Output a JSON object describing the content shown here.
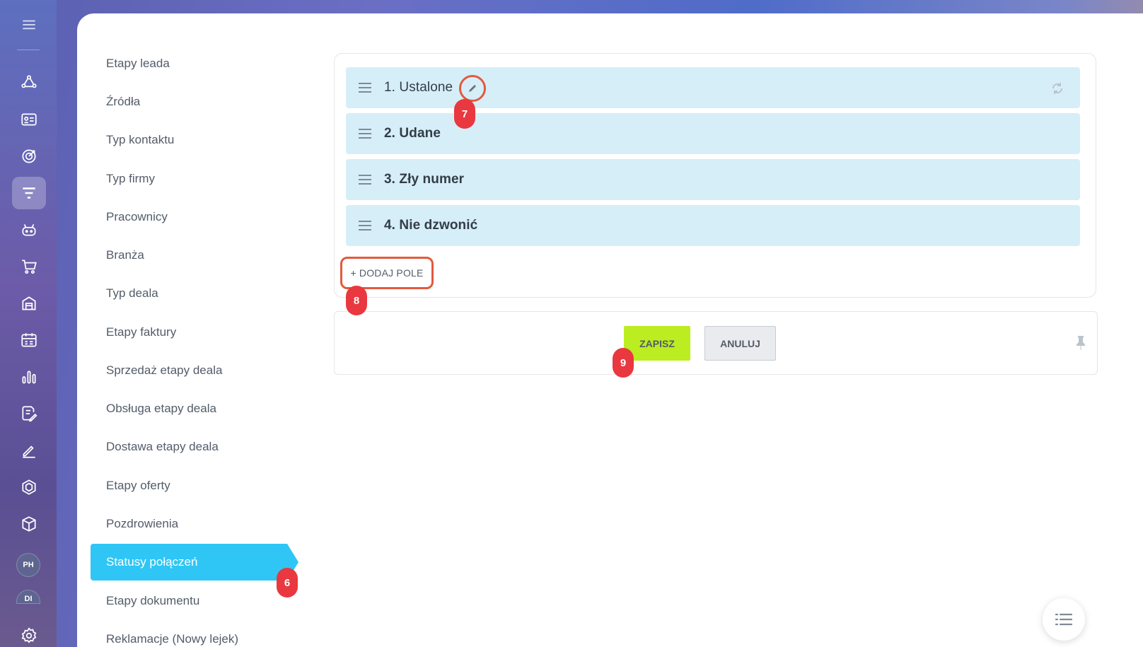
{
  "rail": {
    "icons": [
      "menu-icon",
      "crm-icon",
      "contact-card-icon",
      "target-icon",
      "funnel-icon",
      "robot-icon",
      "cart-icon",
      "warehouse-icon",
      "calendar-icon",
      "analytics-icon",
      "document-edit-icon",
      "signature-icon",
      "hexagon-icon",
      "box-icon",
      "avatar-ph",
      "avatar-di",
      "settings-icon"
    ],
    "avatars": [
      "PH",
      "DI"
    ]
  },
  "menu": {
    "items": [
      "Etapy leada",
      "Źródła",
      "Typ kontaktu",
      "Typ firmy",
      "Pracownicy",
      "Branża",
      "Typ deala",
      "Etapy faktury",
      "Sprzedaż etapy deala",
      "Obsługa etapy deala",
      "Dostawa etapy deala",
      "Etapy oferty",
      "Pozdrowienia",
      "Statusy połączeń",
      "Etapy dokumentu",
      "Reklamacje (Nowy lejek)"
    ],
    "active": "Statusy połączeń"
  },
  "statuses": [
    "1. Ustalone",
    "2. Udane",
    "3. Zły numer",
    "4. Nie dzwonić"
  ],
  "add_field_label": "+ DODAJ POLE",
  "buttons": {
    "save": "ZAPISZ",
    "cancel": "ANULUJ"
  },
  "badges": {
    "b6": "6",
    "b7": "7",
    "b8": "8",
    "b9": "9"
  },
  "colors": {
    "accent": "#2fc6f6",
    "save": "#bbed21",
    "badge": "#e9383f",
    "highlight_ring": "#e25a3c",
    "status_row": "#d6eef8"
  }
}
